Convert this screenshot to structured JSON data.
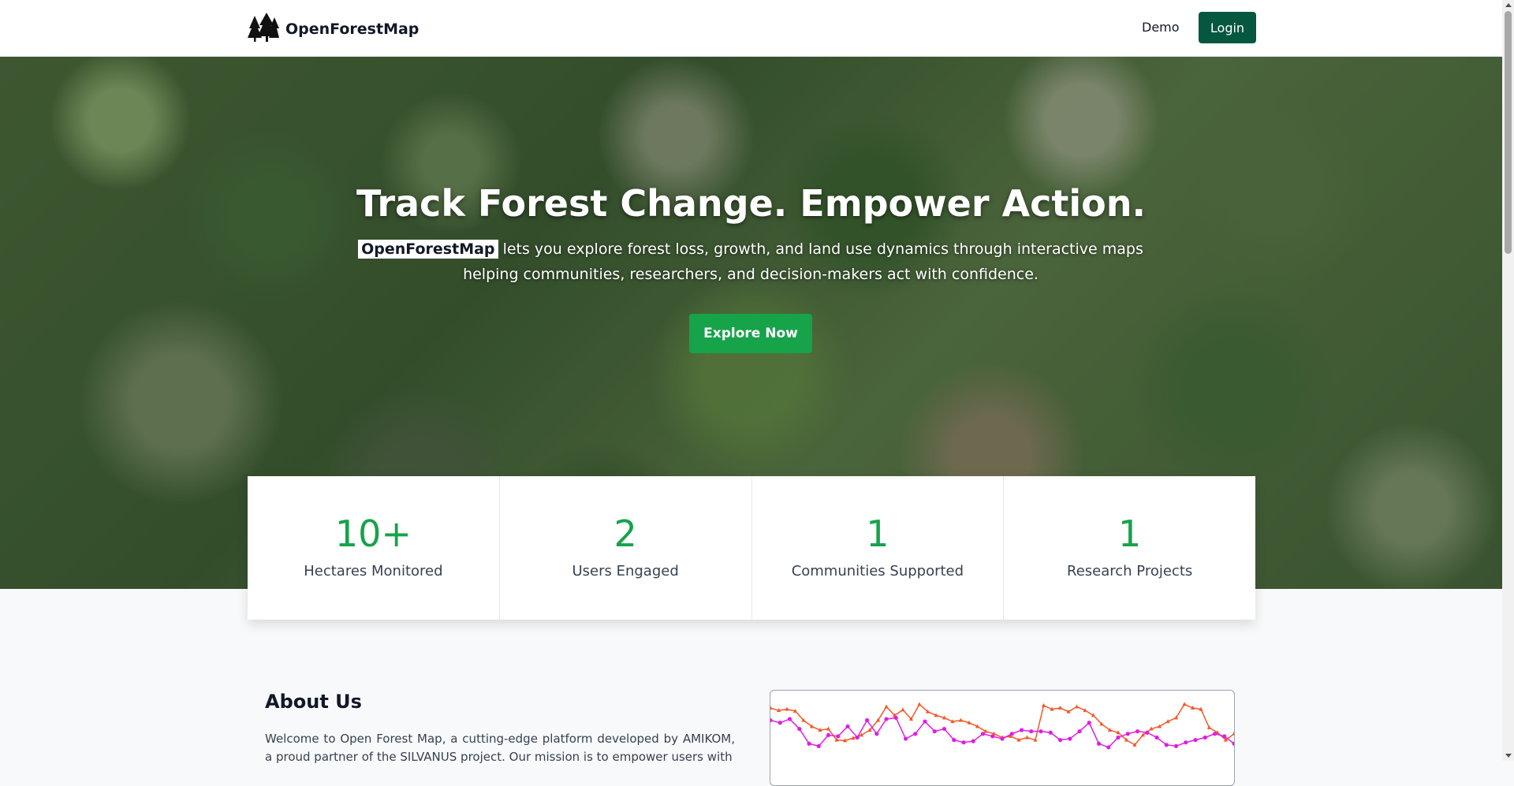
{
  "navbar": {
    "brand": "OpenForestMap",
    "logo_icon": "trees-icon",
    "demo": "Demo",
    "login": "Login"
  },
  "hero": {
    "title": "Track Forest Change. Empower Action.",
    "brand_highlight": "OpenForestMap",
    "subtitle": "lets you explore forest loss, growth, and land use dynamics through interactive maps helping communities, researchers, and decision-makers act with confidence.",
    "cta": "Explore Now"
  },
  "stats": [
    {
      "value": "10+",
      "label": "Hectares Monitored"
    },
    {
      "value": "2",
      "label": "Users Engaged"
    },
    {
      "value": "1",
      "label": "Communities Supported"
    },
    {
      "value": "1",
      "label": "Research Projects"
    }
  ],
  "about": {
    "title": "About Us",
    "text": "Welcome to Open Forest Map, a cutting-edge platform developed by AMIKOM, a proud partner of the SILVANUS project. Our mission is to empower users with"
  },
  "colors": {
    "primary_dark": "#065740",
    "accent_green": "#16a34a",
    "series_orange": "#f05a28",
    "series_magenta": "#e11de1"
  },
  "chart_data": {
    "type": "line",
    "title": "",
    "xlabel": "",
    "ylabel": "",
    "series": [
      {
        "values": [
          0.82,
          0.78,
          0.8,
          0.77,
          0.62,
          0.52,
          0.46,
          0.48,
          0.3,
          0.29,
          0.33,
          0.38,
          0.46,
          0.62,
          0.84,
          0.7,
          0.79,
          0.64,
          0.88,
          0.76,
          0.7,
          0.66,
          0.6,
          0.62,
          0.58,
          0.52,
          0.44,
          0.4,
          0.34,
          0.36,
          0.3,
          0.34,
          0.3,
          0.86,
          0.8,
          0.82,
          0.76,
          0.84,
          0.78,
          0.7,
          0.56,
          0.46,
          0.42,
          0.3,
          0.22,
          0.38,
          0.48,
          0.52,
          0.6,
          0.66,
          0.88,
          0.82,
          0.8,
          0.5,
          0.42,
          0.3,
          0.4
        ]
      },
      {
        "values": [
          0.62,
          0.58,
          0.64,
          0.48,
          0.24,
          0.2,
          0.38,
          0.36,
          0.52,
          0.34,
          0.62,
          0.4,
          0.64,
          0.66,
          0.32,
          0.4,
          0.6,
          0.44,
          0.48,
          0.3,
          0.26,
          0.28,
          0.4,
          0.36,
          0.32,
          0.4,
          0.46,
          0.44,
          0.44,
          0.42,
          0.3,
          0.32,
          0.44,
          0.58,
          0.24,
          0.18,
          0.34,
          0.4,
          0.44,
          0.42,
          0.34,
          0.22,
          0.2,
          0.26,
          0.3,
          0.34,
          0.4,
          0.36,
          0.24
        ]
      }
    ]
  }
}
